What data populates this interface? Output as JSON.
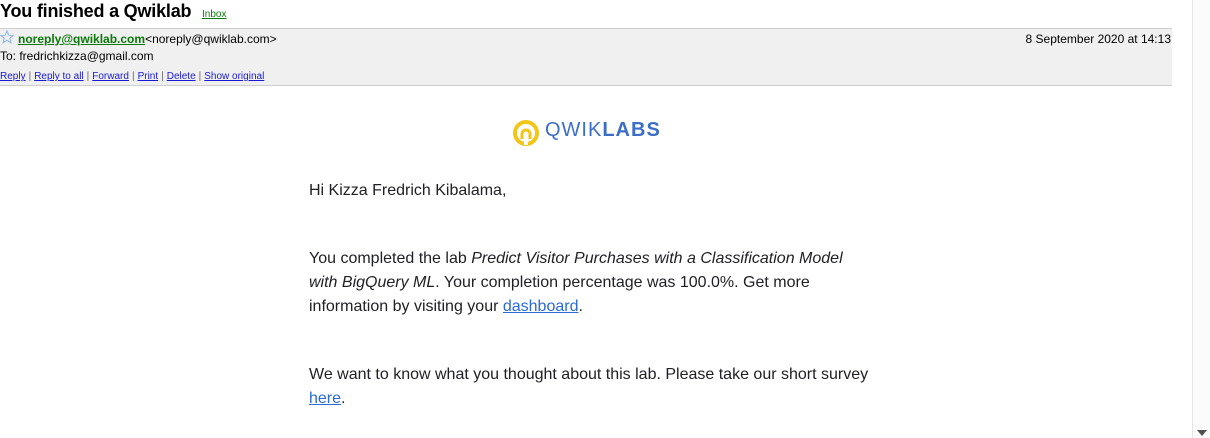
{
  "email": {
    "subject": "You finished a Qwiklab",
    "folder_label": "Inbox",
    "from_address": "noreply@qwiklab.com",
    "from_full": "<noreply@qwiklab.com>",
    "to_line": "To: fredrichkizza@gmail.com",
    "date": "8 September 2020 at 14:13"
  },
  "actions": [
    "Reply",
    "Reply to all",
    "Forward",
    "Print",
    "Delete",
    "Show original"
  ],
  "logo": {
    "word_regular": "QWIK",
    "word_bold": "LABS"
  },
  "content": {
    "greeting": "Hi Kizza Fredrich Kibalama,",
    "p1_prefix": "You completed the lab ",
    "lab_name": "Predict Visitor Purchases with a Classification Model with BigQuery ML",
    "p1_middle": ". Your completion percentage was 100.0%. Get more information by visiting your ",
    "dashboard_link": "dashboard",
    "p1_suffix": ".",
    "p2_prefix": "We want to know what you thought about this lab. Please take our short survey ",
    "survey_link": "here",
    "p2_suffix": "."
  },
  "colors": {
    "accent_link": "#2a6bd4",
    "sender_green": "#0a7a0a",
    "brand_yellow": "#f2c618",
    "brand_blue": "#3d6ec6"
  }
}
